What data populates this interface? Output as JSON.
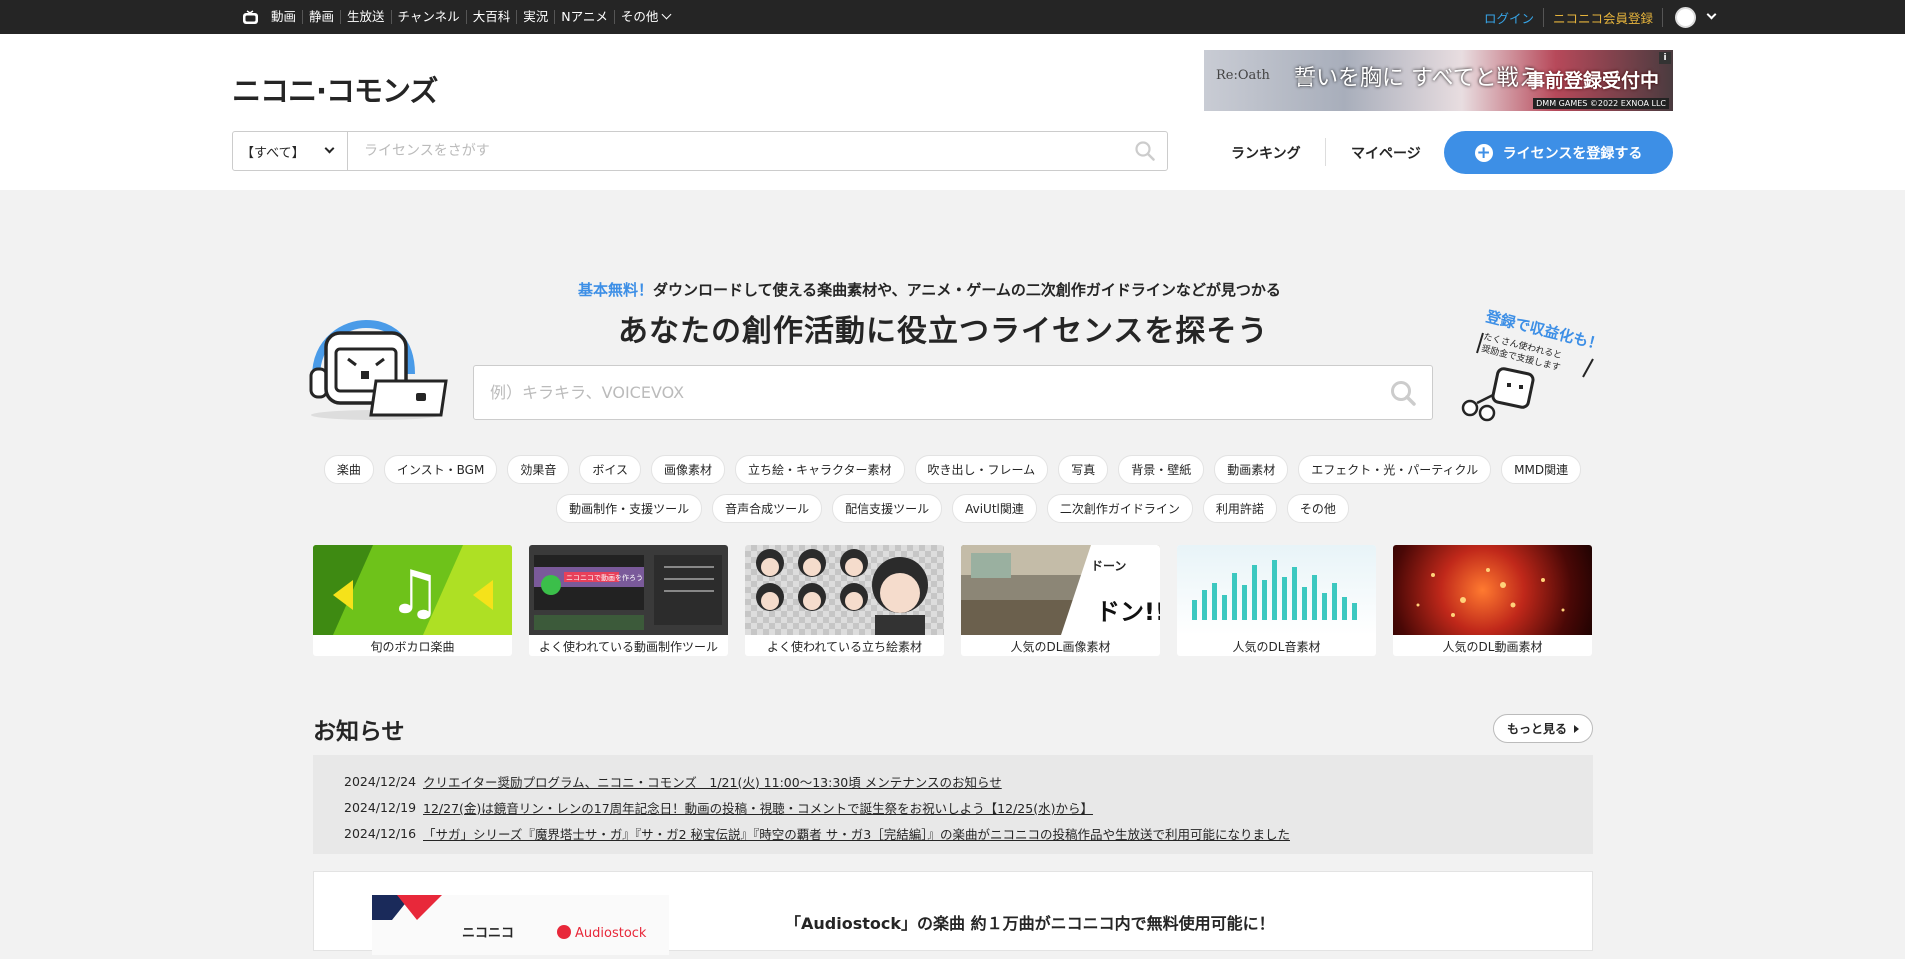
{
  "topbar": {
    "nav": [
      "動画",
      "静画",
      "生放送",
      "チャンネル",
      "大百科",
      "実況",
      "Nアニメ",
      "その他"
    ],
    "login": "ログイン",
    "register": "ニコニコ会員登録"
  },
  "header": {
    "logo": "ニコニ·コモンズ",
    "ad": {
      "logo_text": "Re:Oath",
      "tagline": "誓いを胸に すべてと戦え",
      "badge": "事前登録受付中",
      "copyright": "DMM GAMES ©2022 EXNOA LLC",
      "info": "i"
    },
    "search": {
      "scope": "【すべて】",
      "placeholder": "ライセンスをさがす"
    },
    "ranking": "ランキング",
    "mypage": "マイページ",
    "register_license": "ライセンスを登録する"
  },
  "hero": {
    "sub_highlight": "基本無料！",
    "sub_text": "ダウンロードして使える楽曲素材や、アニメ・ゲームの二次創作ガイドラインなどが見つかる",
    "title": "あなたの創作活動に役立つライセンスを探そう",
    "search_placeholder": "例）キラキラ、VOICEVOX",
    "promo_title": "登録で収益化も！",
    "promo_text1": "たくさん使われると",
    "promo_text2": "奨励金で支援します"
  },
  "tags": [
    "楽曲",
    "インスト・BGM",
    "効果音",
    "ボイス",
    "画像素材",
    "立ち絵・キャラクター素材",
    "吹き出し・フレーム",
    "写真",
    "背景・壁紙",
    "動画素材",
    "エフェクト・光・パーティクル",
    "MMD関連",
    "動画制作・支援ツール",
    "音声合成ツール",
    "配信支援ツール",
    "AviUtl関連",
    "二次創作ガイドライン",
    "利用許諾",
    "その他"
  ],
  "cards": [
    {
      "caption": "旬のボカロ楽曲"
    },
    {
      "caption": "よく使われている動画制作ツール"
    },
    {
      "caption": "よく使われている立ち絵素材"
    },
    {
      "caption": "人気のDL画像素材"
    },
    {
      "caption": "人気のDL音素材"
    },
    {
      "caption": "人気のDL動画素材"
    }
  ],
  "card_extras": {
    "tool_banner": "ニコニコで動画を作ろう",
    "manga_text": "ドン!!"
  },
  "notices": {
    "title": "お知らせ",
    "more": "もっと見る",
    "items": [
      {
        "date": "2024/12/24",
        "text": "クリエイター奨励プログラム、ニコニ・コモンズ　1/21(火) 11:00〜13:30頃 メンテナンスのお知らせ"
      },
      {
        "date": "2024/12/19",
        "text": "12/27(金)は鏡音リン・レンの17周年記念日！動画の投稿・視聴・コメントで誕生祭をお祝いしよう【12/25(水)から】"
      },
      {
        "date": "2024/12/16",
        "text": "「サガ」シリーズ『魔界塔士サ・ガ』『サ・ガ2 秘宝伝説』『時空の覇者 サ・ガ3［完結編］』の楽曲がニコニコの投稿作品や生放送で利用可能になりました"
      }
    ]
  },
  "feature": {
    "title": "「Audiostock」の楽曲 約１万曲がニコニコ内で無料使用可能に！",
    "brand1": "ニコニコ",
    "brand2": "Audiostock"
  },
  "colors": {
    "accent": "#3d8fe6",
    "topbar": "#252525",
    "login": "#37a4e6",
    "register": "#e5b33c"
  }
}
